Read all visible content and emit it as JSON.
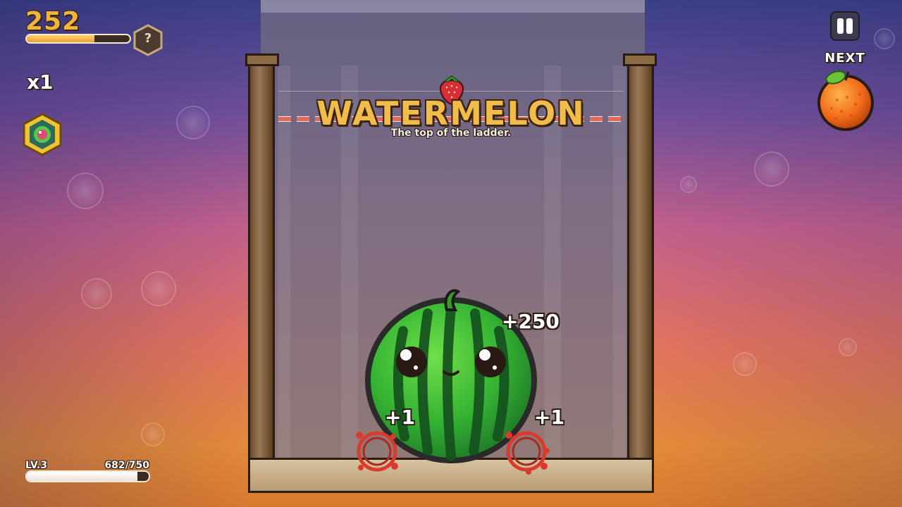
{
  "hud": {
    "score": "252",
    "score_progress": 0.66,
    "help_symbol": "?",
    "multiplier": "x1",
    "badge_icon": "fruit-gem-badge-icon"
  },
  "controls": {
    "pause_icon": "pause-icon",
    "next_label": "NEXT",
    "next_fruit": "orange"
  },
  "level": {
    "label": "LV.3",
    "xp_text": "682/750",
    "xp_current": 682,
    "xp_max": 750
  },
  "banner": {
    "title": "WATERMELON",
    "subtitle": "The top of the ladder.",
    "fruit_icon": "strawberry-icon"
  },
  "board": {
    "fruit": "watermelon",
    "popups": {
      "merge_score": "+250",
      "left": "+1",
      "right": "+1"
    }
  },
  "colors": {
    "score": "#f0b53d",
    "title": "#f2bc4a",
    "outline": "#2a1c12",
    "watermelon": "#3db33a"
  }
}
